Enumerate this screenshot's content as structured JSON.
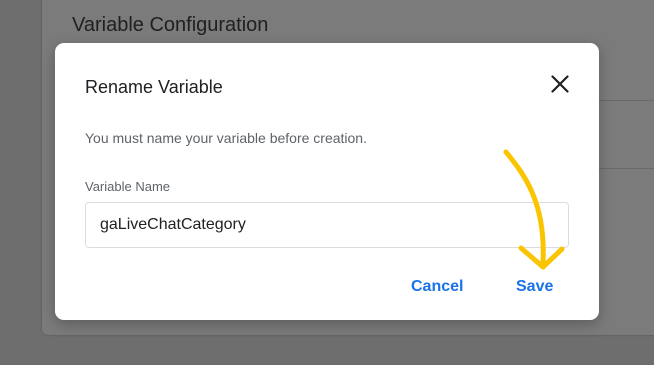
{
  "background": {
    "card_title": "Variable Configuration"
  },
  "dialog": {
    "title": "Rename Variable",
    "description": "You must name your variable before creation.",
    "field_label": "Variable Name",
    "field_value": "gaLiveChatCategory",
    "cancel_label": "Cancel",
    "save_label": "Save",
    "close_icon": "close-icon"
  },
  "colors": {
    "overlay": "#6e6e6e",
    "accent": "#1a73e8",
    "annotation_arrow": "#fbc400"
  }
}
